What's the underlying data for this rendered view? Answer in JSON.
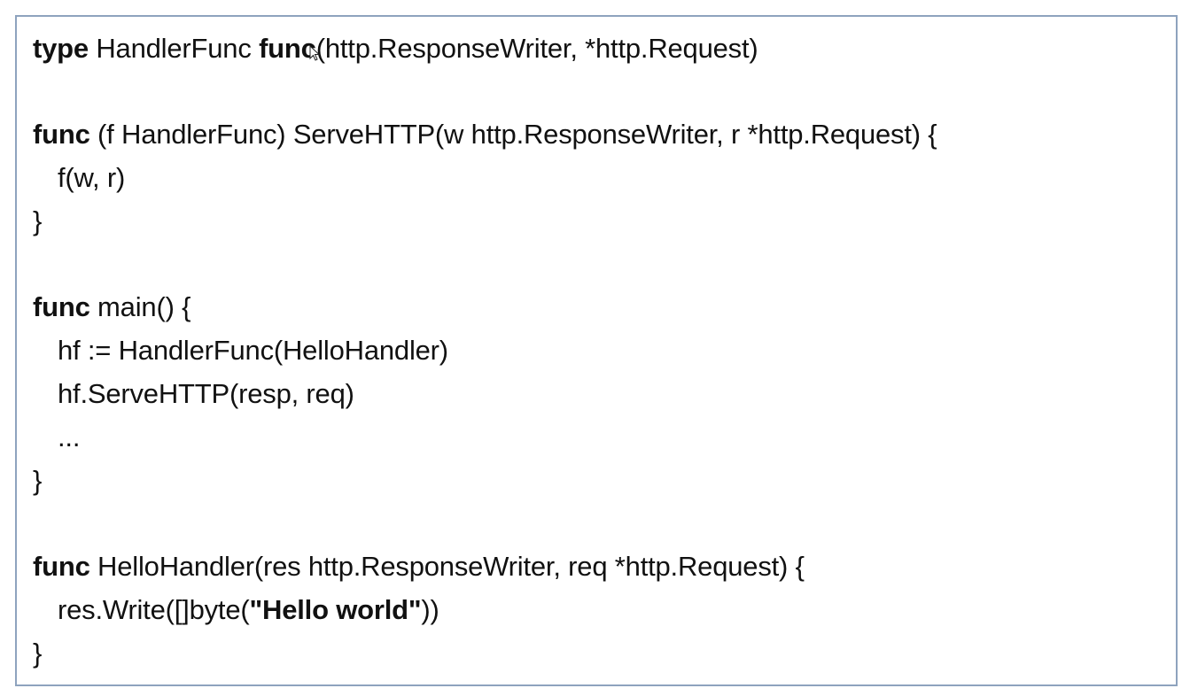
{
  "code": {
    "l1": {
      "kw": "type",
      "a": " HandlerFunc ",
      "kw2": "func",
      "b": "(http.ResponseWriter, *http.Request)"
    },
    "l3": {
      "kw": "func",
      "a": " (f HandlerFunc) ServeHTTP(w http.ResponseWriter, r *http.Request) {"
    },
    "l4": {
      "a": "f(w, r)"
    },
    "l5": {
      "a": "}"
    },
    "l7": {
      "kw": "func",
      "a": " main() {"
    },
    "l8": {
      "a": "hf := HandlerFunc(HelloHandler)"
    },
    "l9": {
      "a": "hf.ServeHTTP(resp, req)"
    },
    "l10": {
      "a": "..."
    },
    "l11": {
      "a": "}"
    },
    "l13": {
      "kw": "func",
      "a": " HelloHandler(res http.ResponseWriter, req *http.Request) {"
    },
    "l14": {
      "a": "res.Write([]byte(",
      "str": "\"Hello world\"",
      "b": "))"
    },
    "l15": {
      "a": "}"
    }
  },
  "cursor_icon": "mouse-pointer-icon"
}
